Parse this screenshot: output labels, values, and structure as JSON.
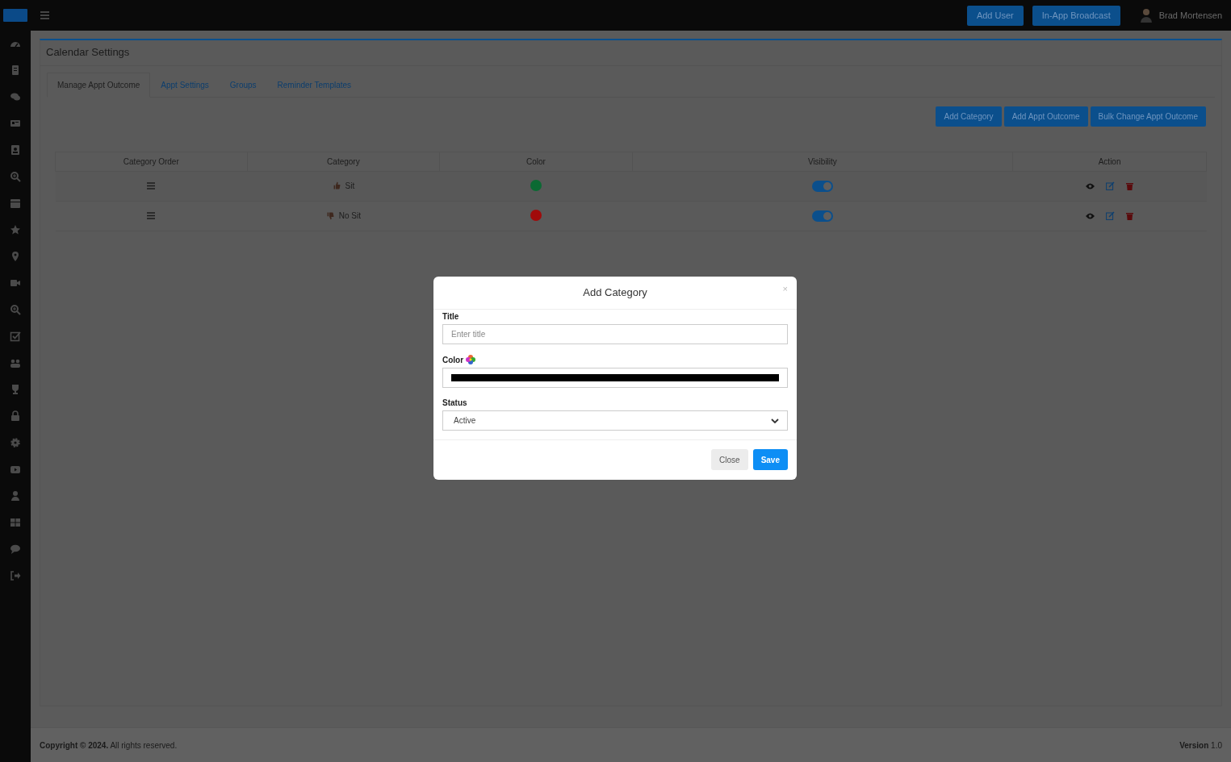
{
  "topbar": {
    "buttons": [
      "Add User",
      "In-App Broadcast"
    ],
    "user_name": "Brad Mortensen"
  },
  "page_title": "Calendar Settings",
  "tabs": [
    {
      "label": "Manage Appt Outcome",
      "selected": true
    },
    {
      "label": "Appt Settings",
      "selected": false
    },
    {
      "label": "Groups",
      "selected": false
    },
    {
      "label": "Reminder Templates",
      "selected": false
    }
  ],
  "actions": [
    "Add Category",
    "Add Appt Outcome",
    "Bulk Change Appt Outcome"
  ],
  "table": {
    "columns": [
      "Category Order",
      "Category",
      "Color",
      "Visibility",
      "Action"
    ],
    "rows": [
      {
        "category": "Sit",
        "kind": "up",
        "color": "#0b6a33",
        "visible": true
      },
      {
        "category": "No Sit",
        "kind": "down",
        "color": "#a10a0a",
        "visible": true
      }
    ]
  },
  "modal": {
    "title": "Add Category",
    "close": "×",
    "fields": [
      {
        "kind": "text",
        "label": "Title",
        "placeholder": "Enter title"
      },
      {
        "kind": "color",
        "label": "Color",
        "color": "#000000"
      },
      {
        "kind": "select",
        "label": "Status",
        "value": "Active"
      }
    ],
    "buttons": [
      {
        "label": "Close",
        "kind": "secondary"
      },
      {
        "label": "Save",
        "kind": "primary"
      }
    ]
  },
  "footer": {
    "copyright": "**Copyright © 2024.** All rights reserved.",
    "version": "**Version** 1.0"
  }
}
